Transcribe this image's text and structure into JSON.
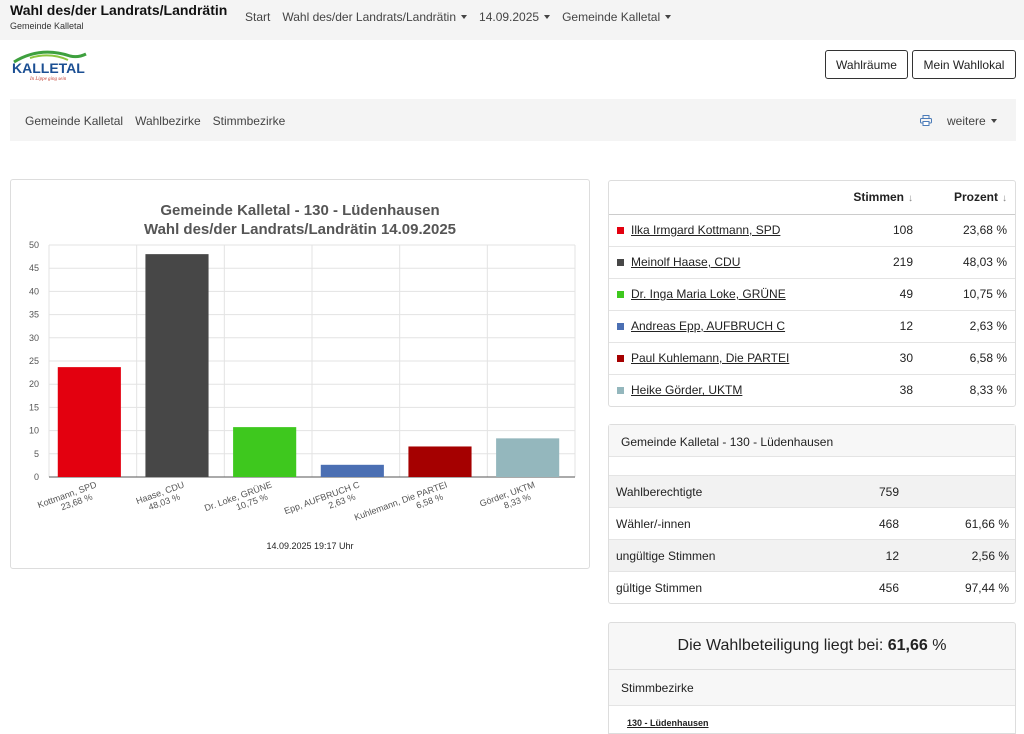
{
  "header": {
    "title": "Wahl des/der Landrats/Landrätin",
    "subtitle": "Gemeinde Kalletal",
    "nav": [
      {
        "label": "Start",
        "dropdown": false
      },
      {
        "label": "Wahl des/der Landrats/Landrätin",
        "dropdown": true
      },
      {
        "label": "14.09.2025",
        "dropdown": true
      },
      {
        "label": "Gemeinde Kalletal",
        "dropdown": true
      }
    ]
  },
  "logo": {
    "text": "KALLETAL",
    "tagline": "In Lippe ging sein"
  },
  "buttons": {
    "wahlraeume": "Wahlräume",
    "mein_wahllokal": "Mein Wahllokal"
  },
  "subnav": {
    "links": [
      "Gemeinde Kalletal",
      "Wahlbezirke",
      "Stimmbezirke"
    ],
    "more": "weitere",
    "icon": "printer-icon"
  },
  "chart_data": {
    "type": "bar",
    "title": "Gemeinde Kalletal - 130 - Lüdenhausen",
    "subtitle": "Wahl des/der Landrats/Landrätin 14.09.2025",
    "footer": "14.09.2025 19:17 Uhr",
    "categories": [
      "Kottmann, SPD",
      "Haase, CDU",
      "Dr. Loke, GRÜNE",
      "Epp, AUFBRUCH C",
      "Kuhlemann, Die PARTEI",
      "Görder, UKTM"
    ],
    "category_pct": [
      "23,68 %",
      "48,03 %",
      "10,75 %",
      "2,63 %",
      "6,58 %",
      "8,33 %"
    ],
    "values": [
      23.68,
      48.03,
      10.75,
      2.63,
      6.58,
      8.33
    ],
    "colors": [
      "#e3000f",
      "#474747",
      "#3ec81e",
      "#4b6fb3",
      "#a50000",
      "#94b7bd"
    ],
    "ylim": [
      0,
      50
    ],
    "yticks": [
      0,
      5,
      10,
      15,
      20,
      25,
      30,
      35,
      40,
      45,
      50
    ],
    "grid": true
  },
  "results": {
    "col_stimmen": "Stimmen",
    "col_prozent": "Prozent",
    "rows": [
      {
        "name": "Ilka Irmgard Kottmann, SPD",
        "votes": "108",
        "pct": "23,68 %",
        "color": "#e3000f"
      },
      {
        "name": "Meinolf Haase, CDU",
        "votes": "219",
        "pct": "48,03 %",
        "color": "#474747"
      },
      {
        "name": "Dr. Inga Maria Loke, GRÜNE",
        "votes": "49",
        "pct": "10,75 %",
        "color": "#3ec81e"
      },
      {
        "name": "Andreas Epp, AUFBRUCH C",
        "votes": "12",
        "pct": "2,63 %",
        "color": "#4b6fb3"
      },
      {
        "name": "Paul Kuhlemann, Die PARTEI",
        "votes": "30",
        "pct": "6,58 %",
        "color": "#a50000"
      },
      {
        "name": "Heike Görder, UKTM",
        "votes": "38",
        "pct": "8,33 %",
        "color": "#94b7bd"
      }
    ]
  },
  "stats": {
    "title": "Gemeinde Kalletal - 130 - Lüdenhausen",
    "rows": [
      {
        "label": "Wahlberechtigte",
        "value": "759",
        "pct": ""
      },
      {
        "label": "Wähler/-innen",
        "value": "468",
        "pct": "61,66 %"
      },
      {
        "label": "ungültige Stimmen",
        "value": "12",
        "pct": "2,56 %"
      },
      {
        "label": "gültige Stimmen",
        "value": "456",
        "pct": "97,44 %"
      }
    ]
  },
  "turnout": {
    "text": "Die Wahlbeteiligung liegt bei:",
    "value": "61,66",
    "unit": "%"
  },
  "stimmbezirke": {
    "title": "Stimmbezirke",
    "link": "130 - Lüdenhausen"
  }
}
